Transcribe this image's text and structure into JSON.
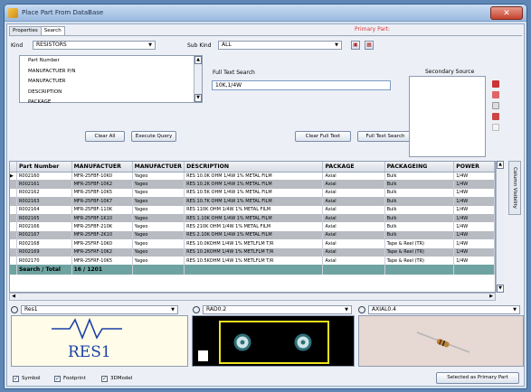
{
  "window": {
    "title": "Place Part From DataBase",
    "close_glyph": "✕"
  },
  "tabs": [
    {
      "label": "Properties"
    },
    {
      "label": "Search"
    }
  ],
  "primary_part_label": "Primary Part:",
  "kind": {
    "label": "Kind",
    "value": "RESISTORS"
  },
  "subkind": {
    "label": "Sub Kind",
    "value": "ALL"
  },
  "fields_list": {
    "items": [
      "Part Number",
      "MANUFACTUER P/N",
      "MANUFACTUER",
      "DESCRIPTION",
      "PACKAGE"
    ]
  },
  "buttons": {
    "clear_all": "Clear All",
    "execute_query": "Execute Query",
    "clear_full_text": "Clear Full Text",
    "full_text_search": "Full Text Search",
    "selected_as_primary": "Selected as Primary Part"
  },
  "full_text_search": {
    "label": "Full Text Search",
    "value": "10K,1/4W"
  },
  "secondary_source_label": "Secondary Source",
  "column_visibility_label": "Column Visibility",
  "grid": {
    "columns": [
      "Part Number",
      "MANUFACTUER",
      "MANUFACTUER",
      "DESCRIPTION",
      "PACKAGE",
      "PACKAGEING",
      "POWER"
    ],
    "rows": [
      [
        "R002160",
        "MFR-25FBF-10K0",
        "Yageo",
        "RES 10.0K OHM 1/4W 1% METAL FILM",
        "Axial",
        "Bulk",
        "1/4W"
      ],
      [
        "R002161",
        "MFR-25FBF-10K2",
        "Yageo",
        "RES 10.2K OHM 1/4W 1% METAL FILM",
        "Axial",
        "Bulk",
        "1/4W"
      ],
      [
        "R002162",
        "MFR-25FBF-10K5",
        "Yageo",
        "RES 10.5K OHM 1/4W 1% METAL FILM",
        "Axial",
        "Bulk",
        "1/4W"
      ],
      [
        "R002163",
        "MFR-25FBF-10K7",
        "Yageo",
        "RES 10.7K OHM 1/4W 1% METAL FILM",
        "Axial",
        "Bulk",
        "1/4W"
      ],
      [
        "R002164",
        "MFR-25FBF-110K",
        "Yageo",
        "RES 110K OHM 1/4W 1% METAL FILM",
        "Axial",
        "Bulk",
        "1/4W"
      ],
      [
        "R002165",
        "MFR-25FBF-1K10",
        "Yageo",
        "RES 1.10K OHM 1/4W 1% METAL FILM",
        "Axial",
        "Bulk",
        "1/4W"
      ],
      [
        "R002166",
        "MFR-25FBF-210K",
        "Yageo",
        "RES 210K OHM 1/4W 1% METAL FILM",
        "Axial",
        "Bulk",
        "1/4W"
      ],
      [
        "R002167",
        "MFR-25FBF-2K10",
        "Yageo",
        "RES 2.10K OHM 1/4W 1% METAL FILM",
        "Axial",
        "Bulk",
        "1/4W"
      ],
      [
        "R002168",
        "MFR-25FRF-10K0",
        "Yageo",
        "RES 10.0KOHM 1/4W 1% METLFLM T/R",
        "Axial",
        "Tape & Reel (TR)",
        "1/4W"
      ],
      [
        "R002169",
        "MFR-25FRF-10K2",
        "Yageo",
        "RES 10.2KOHM 1/4W 1% METLFLM T/R",
        "Axial",
        "Tape & Reel (TR)",
        "1/4W"
      ],
      [
        "R002170",
        "MFR-25FRF-10K5",
        "Yageo",
        "RES 10.5KOHM 1/4W 1% METLFLM T/R",
        "Axial",
        "Tape & Reel (TR)",
        "1/4W"
      ]
    ],
    "total_label": "Search / Total",
    "total_value": "16 / 1201"
  },
  "previews": {
    "symbol_combo": "Res1",
    "footprint_combo": "RAD0.2",
    "model_combo": "AXIAL0.4",
    "symbol_text": "RES1"
  },
  "checkboxes": [
    {
      "label": "Symbol",
      "checked": true
    },
    {
      "label": "Footprint",
      "checked": true
    },
    {
      "label": "3DModel",
      "checked": true
    }
  ],
  "icons": {
    "app": "app-icon",
    "search": "magnifier-icon"
  }
}
